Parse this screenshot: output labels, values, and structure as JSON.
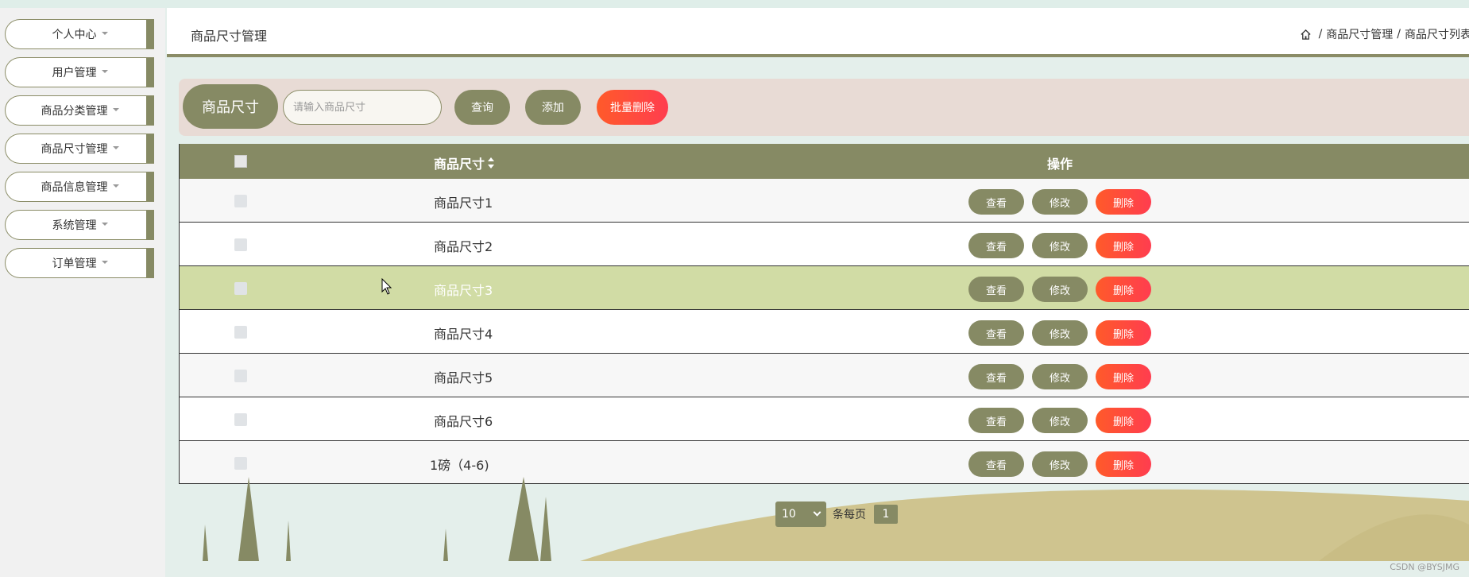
{
  "sidebar": {
    "items": [
      {
        "label": "个人中心"
      },
      {
        "label": "用户管理"
      },
      {
        "label": "商品分类管理"
      },
      {
        "label": "商品尺寸管理"
      },
      {
        "label": "商品信息管理"
      },
      {
        "label": "系统管理"
      },
      {
        "label": "订单管理"
      }
    ]
  },
  "header": {
    "title": "商品尺寸管理",
    "breadcrumb": [
      "商品尺寸管理",
      "商品尺寸列表"
    ]
  },
  "search": {
    "label": "商品尺寸",
    "placeholder": "请输入商品尺寸",
    "value": "",
    "query_button": "查询",
    "add_button": "添加",
    "batch_delete_button": "批量删除"
  },
  "table": {
    "columns": {
      "name": "商品尺寸",
      "operation": "操作"
    },
    "rows": [
      {
        "name": "商品尺寸1"
      },
      {
        "name": "商品尺寸2"
      },
      {
        "name": "商品尺寸3"
      },
      {
        "name": "商品尺寸4"
      },
      {
        "name": "商品尺寸5"
      },
      {
        "name": "商品尺寸6"
      },
      {
        "name": "1磅（4-6)"
      }
    ],
    "hover_row": 3,
    "actions": {
      "view": "查看",
      "edit": "修改",
      "delete": "删除"
    }
  },
  "pagination": {
    "page_size": "10",
    "per_page_text": "条每页",
    "current_page": "1"
  },
  "watermark": "CSDN @BYSJMG",
  "colors": {
    "accent": "#868a64",
    "danger": "#ff4a3a",
    "hover_row": "#d1dca5",
    "search_bg": "#e8dbd5",
    "page_bg": "#e4efeb"
  }
}
